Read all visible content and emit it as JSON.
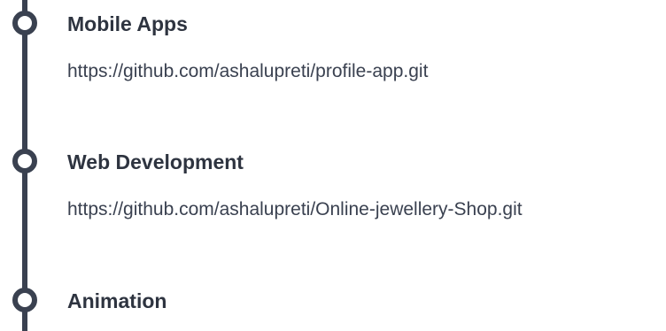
{
  "projects": [
    {
      "title": "Mobile Apps",
      "link": "https://github.com/ashalupreti/profile-app.git"
    },
    {
      "title": "Web Development",
      "link": "https://github.com/ashalupreti/Online-jewellery-Shop.git"
    },
    {
      "title": "Animation"
    }
  ],
  "colors": {
    "timeline": "#3a4150",
    "title": "#2e3440",
    "link": "#3a4150",
    "background": "#ffffff"
  },
  "icons": {
    "timeline_node": "hollow-circle-icon"
  }
}
